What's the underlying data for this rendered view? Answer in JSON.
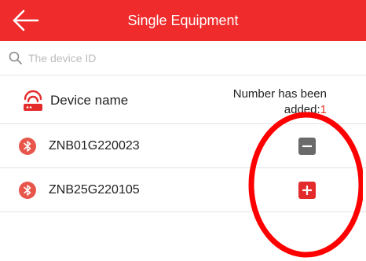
{
  "header": {
    "title": "Single Equipment",
    "back_icon": "arrow-left-icon",
    "background": "#ef2b2b"
  },
  "search": {
    "placeholder": "The device ID",
    "value": "",
    "icon": "search-icon"
  },
  "list_header": {
    "device_name_label": "Device name",
    "count_label": "Number has been",
    "count_label_suffix": "added:",
    "count_value": "1",
    "icon": "router-icon"
  },
  "devices": [
    {
      "id": "ZNB01G220023",
      "icon": "bluetooth-icon",
      "action": "remove",
      "action_icon": "minus-icon",
      "action_color": "#6a6a6a"
    },
    {
      "id": "ZNB25G220105",
      "icon": "bluetooth-icon",
      "action": "add",
      "action_icon": "plus-icon",
      "action_color": "#e32b2b"
    }
  ],
  "annotation": {
    "type": "circle",
    "color": "#ff0000"
  }
}
